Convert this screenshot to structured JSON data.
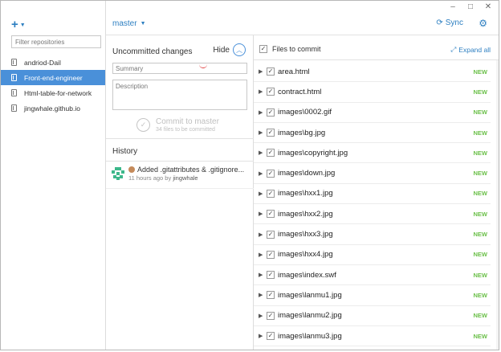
{
  "window_controls": {
    "minimize": "–",
    "maximize": "□",
    "close": "✕"
  },
  "sidebar": {
    "add_label": "+",
    "filter_placeholder": "Filter repositories",
    "repos": [
      {
        "name": "andriod-Dail",
        "active": false
      },
      {
        "name": "Front-end-engineer",
        "active": true
      },
      {
        "name": "Html-table-for-network",
        "active": false
      },
      {
        "name": "jingwhale.github.io",
        "active": false
      }
    ]
  },
  "header": {
    "branch": "master",
    "sync_label": "Sync"
  },
  "uncommitted": {
    "title": "Uncommitted changes",
    "hide_label": "Hide",
    "summary_placeholder": "Summary",
    "description_placeholder": "Description",
    "commit_title": "Commit to master",
    "commit_sub": "34 files to be committed"
  },
  "history": {
    "title": "History",
    "items": [
      {
        "message": "Added .gitattributes & .gitignore...",
        "time": "11 hours ago by",
        "author": "jingwhale"
      }
    ]
  },
  "files": {
    "title": "Files to commit",
    "expand_label": "Expand all",
    "items": [
      {
        "name": "area.html",
        "status": "NEW"
      },
      {
        "name": "contract.html",
        "status": "NEW"
      },
      {
        "name": "images\\0002.gif",
        "status": "NEW"
      },
      {
        "name": "images\\bg.jpg",
        "status": "NEW"
      },
      {
        "name": "images\\copyright.jpg",
        "status": "NEW"
      },
      {
        "name": "images\\down.jpg",
        "status": "NEW"
      },
      {
        "name": "images\\hxx1.jpg",
        "status": "NEW"
      },
      {
        "name": "images\\hxx2.jpg",
        "status": "NEW"
      },
      {
        "name": "images\\hxx3.jpg",
        "status": "NEW"
      },
      {
        "name": "images\\hxx4.jpg",
        "status": "NEW"
      },
      {
        "name": "images\\index.swf",
        "status": "NEW"
      },
      {
        "name": "images\\lanmu1.jpg",
        "status": "NEW"
      },
      {
        "name": "images\\lanmu2.jpg",
        "status": "NEW"
      },
      {
        "name": "images\\lanmu3.jpg",
        "status": "NEW"
      }
    ]
  },
  "colors": {
    "accent": "#2d7fc1",
    "selected": "#4a90d9",
    "new_status": "#6cc04a"
  }
}
